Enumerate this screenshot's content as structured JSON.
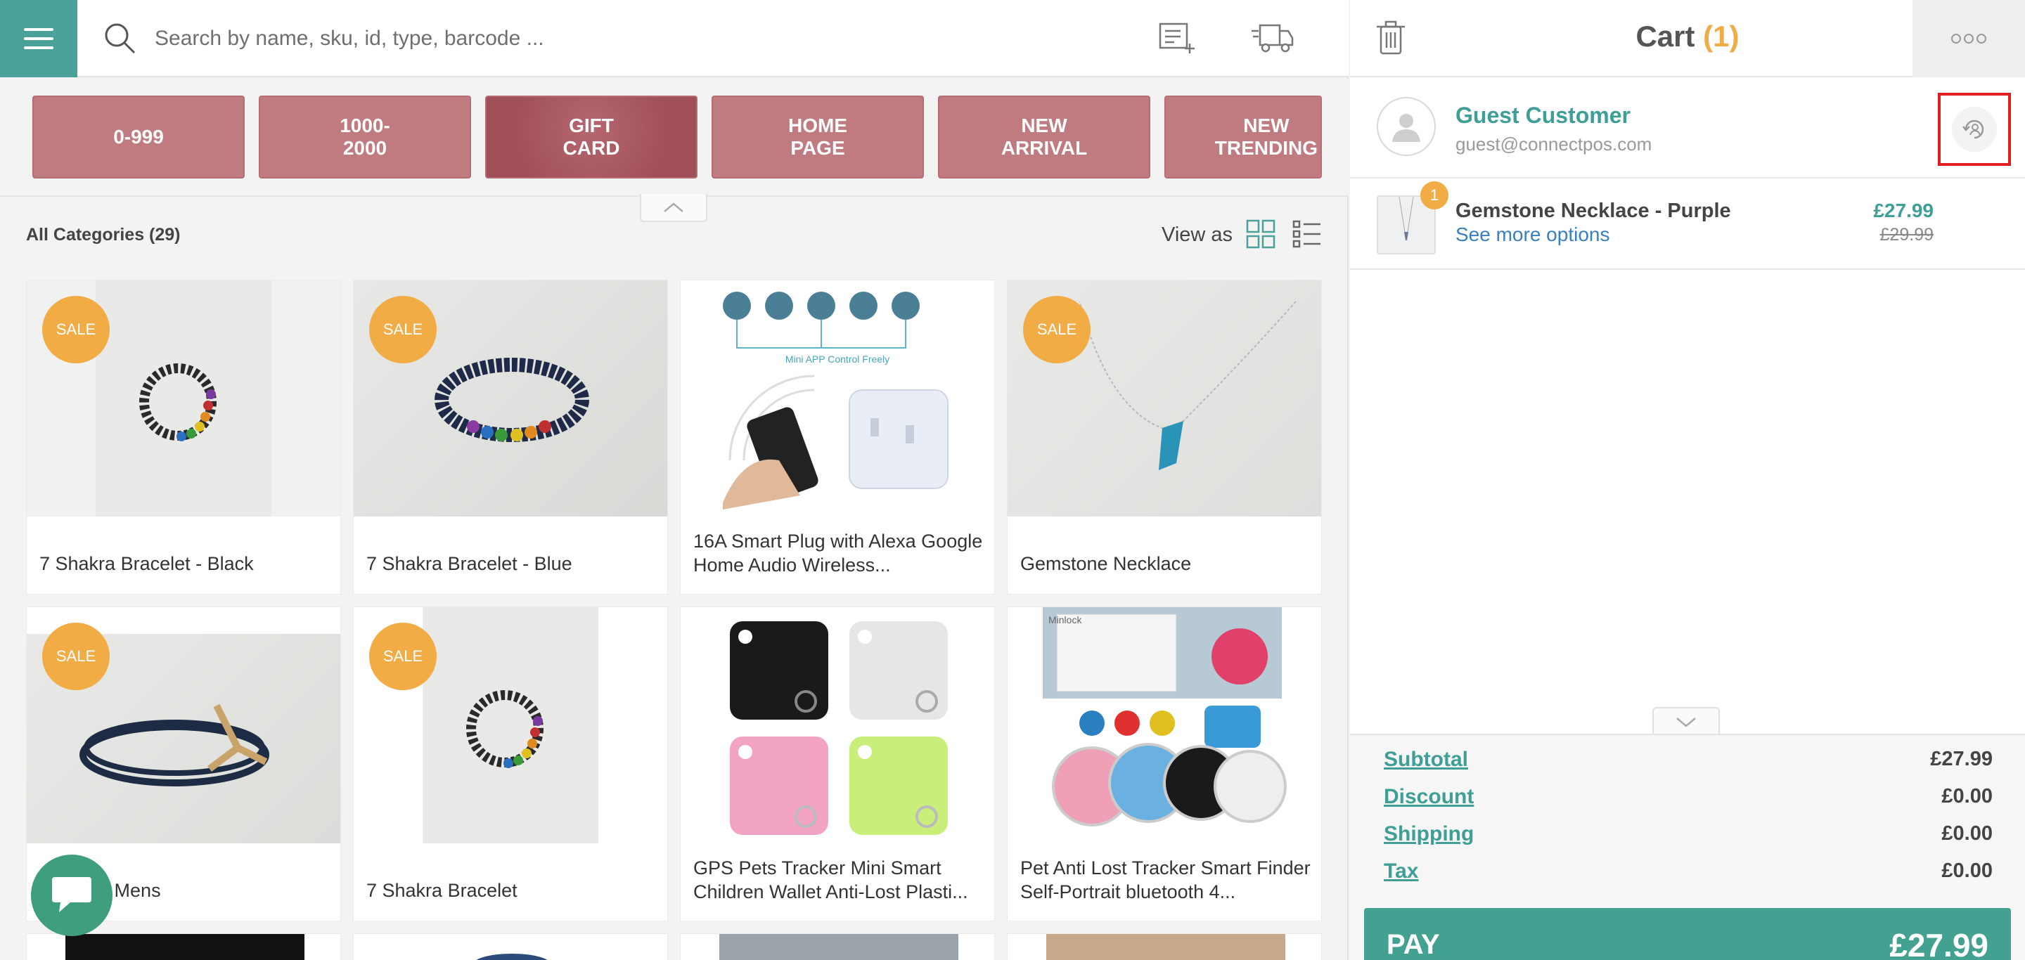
{
  "search": {
    "placeholder": "Search by name, sku, id, type, barcode ..."
  },
  "categories_bar": {
    "items": [
      {
        "label": "0-999"
      },
      {
        "label": "1000-\n2000"
      },
      {
        "label": "GIFT\nCARD"
      },
      {
        "label": "HOME\nPAGE"
      },
      {
        "label": "NEW\nARRIVAL"
      },
      {
        "label": "NEW\nTRENDING"
      }
    ]
  },
  "catalog": {
    "title": "All Categories (29)",
    "view_as_label": "View as",
    "sale_badge": "SALE",
    "products": [
      {
        "name": "7 Shakra Bracelet - Black",
        "sale": true
      },
      {
        "name": "7 Shakra Bracelet - Blue",
        "sale": true
      },
      {
        "name": "16A Smart Plug with Alexa Google Home Audio Wireless...",
        "sale": false,
        "image_caption": "Mini APP Control Freely"
      },
      {
        "name": "Gemstone Necklace",
        "sale": true
      },
      {
        "name": "Bracelet Mens",
        "sale": true
      },
      {
        "name": "7 Shakra Bracelet",
        "sale": true
      },
      {
        "name": "GPS Pets Tracker Mini Smart Children Wallet Anti-Lost Plasti...",
        "sale": false
      },
      {
        "name": "Pet Anti Lost Tracker Smart Finder Self-Portrait bluetooth 4...",
        "sale": false,
        "image_caption": "Minlock"
      }
    ]
  },
  "cart": {
    "title": "Cart",
    "count": "(1)",
    "customer": {
      "name": "Guest Customer",
      "email": "guest@connectpos.com"
    },
    "items": [
      {
        "qty": "1",
        "name": "Gemstone Necklace - Purple",
        "link": "See more options",
        "price": "£27.99",
        "old_price": "£29.99"
      }
    ],
    "totals": [
      {
        "label": "Subtotal",
        "value": "£27.99"
      },
      {
        "label": "Discount",
        "value": "£0.00"
      },
      {
        "label": "Shipping",
        "value": "£0.00"
      },
      {
        "label": "Tax",
        "value": "£0.00"
      }
    ],
    "pay": {
      "label": "PAY",
      "amount": "£27.99"
    }
  },
  "colors": {
    "accent": "#4aa199",
    "category": "#c07b80",
    "sale": "#f2ac45",
    "pay": "#42a190",
    "highlight": "#e02020"
  },
  "icons": [
    "menu-icon",
    "search-icon",
    "add-note-icon",
    "shipping-truck-icon",
    "trash-icon",
    "more-icon",
    "user-icon",
    "customer-switch-icon",
    "chevron-up-icon",
    "chevron-down-icon",
    "grid-view-icon",
    "list-view-icon",
    "chat-icon"
  ]
}
